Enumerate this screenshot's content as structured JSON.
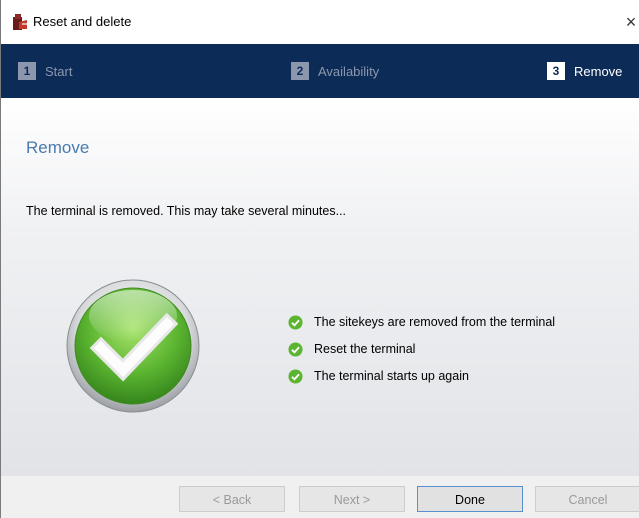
{
  "window": {
    "title": "Reset and delete",
    "close_glyph": "×"
  },
  "steps": [
    {
      "number": "1",
      "label": "Start",
      "active": false
    },
    {
      "number": "2",
      "label": "Availability",
      "active": false
    },
    {
      "number": "3",
      "label": "Remove",
      "active": true
    }
  ],
  "main": {
    "section_title": "Remove",
    "description": "The terminal is removed. This may take several minutes...",
    "status_icon": "success-check-icon",
    "checklist": [
      {
        "text": "The sitekeys are removed from the terminal",
        "status": "done"
      },
      {
        "text": "Reset the terminal",
        "status": "done"
      },
      {
        "text": "The terminal starts up again",
        "status": "done"
      }
    ]
  },
  "footer": {
    "back_label": "< Back",
    "next_label": "Next >",
    "done_label": "Done",
    "cancel_label": "Cancel"
  },
  "colors": {
    "step_bar": "#0d2b57",
    "accent_title": "#4a7ab0",
    "success_green": "#5cb531"
  }
}
